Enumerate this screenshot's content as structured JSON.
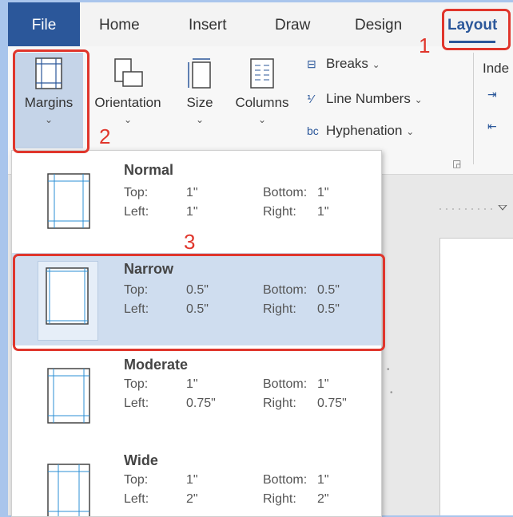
{
  "tabs": {
    "file": "File",
    "home": "Home",
    "insert": "Insert",
    "draw": "Draw",
    "design": "Design",
    "layout": "Layout"
  },
  "ribbon": {
    "margins": "Margins",
    "orientation": "Orientation",
    "size": "Size",
    "columns": "Columns",
    "breaks": "Breaks",
    "line_numbers": "Line Numbers",
    "hyphenation": "Hyphenation",
    "indent": "Inde"
  },
  "steps": [
    "1",
    "2",
    "3"
  ],
  "margins_menu": [
    {
      "name": "Normal",
      "top_label": "Top:",
      "top": "1\"",
      "bottom_label": "Bottom:",
      "bottom": "1\"",
      "left_label": "Left:",
      "left": "1\"",
      "right_label": "Right:",
      "right": "1\""
    },
    {
      "name": "Narrow",
      "top_label": "Top:",
      "top": "0.5\"",
      "bottom_label": "Bottom:",
      "bottom": "0.5\"",
      "left_label": "Left:",
      "left": "0.5\"",
      "right_label": "Right:",
      "right": "0.5\""
    },
    {
      "name": "Moderate",
      "top_label": "Top:",
      "top": "1\"",
      "bottom_label": "Bottom:",
      "bottom": "1\"",
      "left_label": "Left:",
      "left": "0.75\"",
      "right_label": "Right:",
      "right": "0.75\""
    },
    {
      "name": "Wide",
      "top_label": "Top:",
      "top": "1\"",
      "bottom_label": "Bottom:",
      "bottom": "1\"",
      "left_label": "Left:",
      "left": "2\"",
      "right_label": "Right:",
      "right": "2\""
    }
  ],
  "colors": {
    "accent": "#2b579a",
    "annotation": "#e0362c",
    "selection": "#cfddef"
  }
}
